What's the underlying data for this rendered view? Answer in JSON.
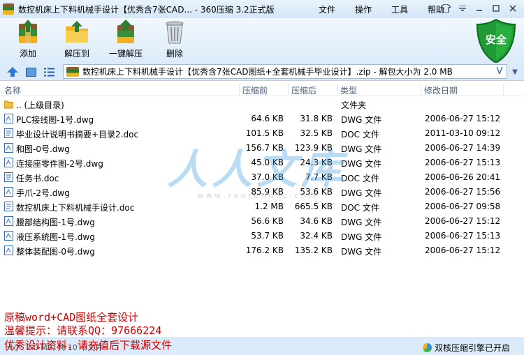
{
  "window": {
    "title": "数控机床上下料机械手设计【优秀含7张CAD...  - 360压缩 3.2正式版",
    "menus": [
      "文件",
      "操作",
      "工具",
      "帮助"
    ]
  },
  "toolbar": {
    "add_label": "添加",
    "extract_label": "解压到",
    "oneclick_label": "一键解压",
    "delete_label": "删除",
    "security_label": "安全"
  },
  "address": {
    "path": "数控机床上下料机械手设计【优秀含7张CAD图纸+全套机械手毕业设计】.zip - 解包大小为 2.0 MB",
    "v_symbol": "V"
  },
  "columns": {
    "name": "名称",
    "size": "压缩前",
    "packed": "压缩后",
    "type": "类型",
    "date": "修改日期"
  },
  "files": [
    {
      "name": ".. (上级目录)",
      "size": "",
      "packed": "",
      "type": "文件夹",
      "date": "",
      "icon": "folder-icon"
    },
    {
      "name": "PLC接线图-1号.dwg",
      "size": "64.6 KB",
      "packed": "31.8 KB",
      "type": "DWG 文件",
      "date": "2006-06-27 15:12",
      "icon": "dwg-file-icon"
    },
    {
      "name": "毕业设计说明书摘要+目录2.doc",
      "size": "101.5 KB",
      "packed": "32.5 KB",
      "type": "DOC 文件",
      "date": "2011-03-10 09:12",
      "icon": "doc-file-icon"
    },
    {
      "name": "和图-0号.dwg",
      "size": "156.7 KB",
      "packed": "123.9 KB",
      "type": "DWG 文件",
      "date": "2006-06-27 14:39",
      "icon": "dwg-file-icon"
    },
    {
      "name": "连接座零件图-2号.dwg",
      "size": "45.0 KB",
      "packed": "24.3 KB",
      "type": "DWG 文件",
      "date": "2006-06-27 15:13",
      "icon": "dwg-file-icon"
    },
    {
      "name": "任务书.doc",
      "size": "37.0 KB",
      "packed": "7.7 KB",
      "type": "DOC 文件",
      "date": "2006-06-26 20:41",
      "icon": "doc-file-icon"
    },
    {
      "name": "手爪-2号.dwg",
      "size": "85.9 KB",
      "packed": "53.6 KB",
      "type": "DWG 文件",
      "date": "2006-06-27 15:56",
      "icon": "dwg-file-icon"
    },
    {
      "name": "数控机床上下料机械手设计.doc",
      "size": "1.2 MB",
      "packed": "665.5 KB",
      "type": "DOC 文件",
      "date": "2006-06-27 09:58",
      "icon": "doc-file-icon"
    },
    {
      "name": "腰部结构图-1号.dwg",
      "size": "56.6 KB",
      "packed": "34.6 KB",
      "type": "DWG 文件",
      "date": "2006-06-27 15:12",
      "icon": "dwg-file-icon"
    },
    {
      "name": "液压系统图-1号.dwg",
      "size": "53.7 KB",
      "packed": "32.4 KB",
      "type": "DWG 文件",
      "date": "2006-06-27 15:13",
      "icon": "dwg-file-icon"
    },
    {
      "name": "整体装配图-0号.dwg",
      "size": "176.2 KB",
      "packed": "135.2 KB",
      "type": "DWG 文件",
      "date": "2006-06-27 15:12",
      "icon": "dwg-file-icon"
    }
  ],
  "watermark": {
    "text": "人人文库",
    "url": "w w w . r e n r e n d o c . c o m"
  },
  "overlay": {
    "line1": "原稿word+CAD图纸全套设计",
    "line2": "温馨提示：请联系QQ：97666224",
    "line3": "优秀设计资料，请充值后下载源文件"
  },
  "status": {
    "left": "大小: 2.0 MB, 共 10 个文件",
    "right": "双核压缩引擎已开启"
  }
}
